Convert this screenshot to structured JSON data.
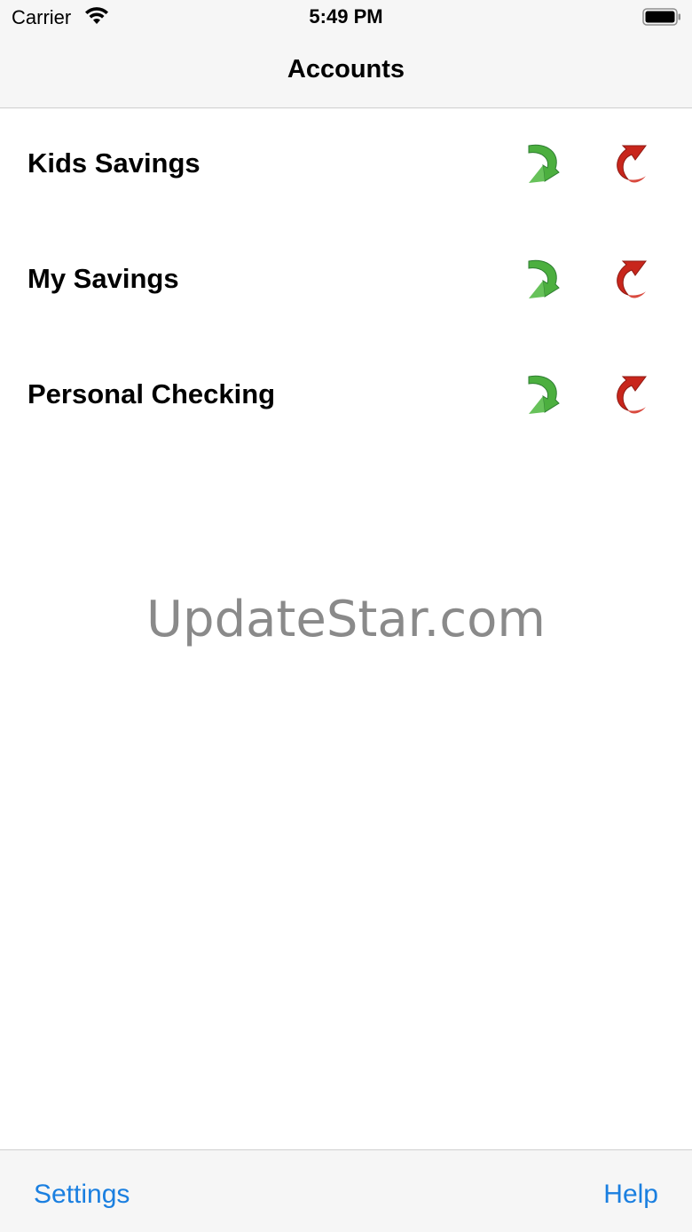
{
  "status_bar": {
    "carrier": "Carrier",
    "time": "5:49 PM",
    "wifi_icon": "wifi-icon",
    "battery_icon": "battery-icon"
  },
  "nav": {
    "title": "Accounts"
  },
  "accounts": [
    {
      "name": "Kids Savings",
      "deposit_icon": "green-curved-arrow-icon",
      "withdraw_icon": "red-curved-arrow-icon"
    },
    {
      "name": "My Savings",
      "deposit_icon": "green-curved-arrow-icon",
      "withdraw_icon": "red-curved-arrow-icon"
    },
    {
      "name": "Personal Checking",
      "deposit_icon": "green-curved-arrow-icon",
      "withdraw_icon": "red-curved-arrow-icon"
    }
  ],
  "watermark": "UpdateStar.com",
  "toolbar": {
    "settings_label": "Settings",
    "help_label": "Help"
  },
  "colors": {
    "accent": "#1a7fe0",
    "deposit_green": "#4caf3f",
    "withdraw_red": "#c8261c",
    "bar_background": "#f6f6f6"
  }
}
